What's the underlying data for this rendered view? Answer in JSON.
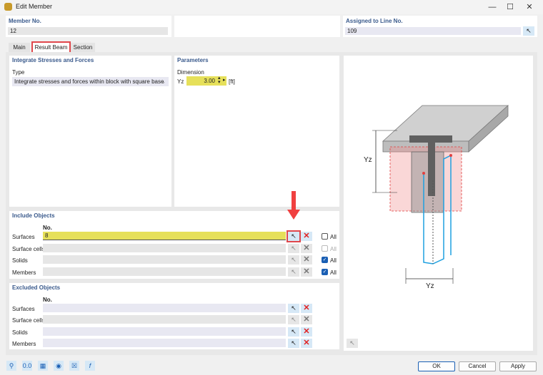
{
  "window": {
    "title": "Edit Member"
  },
  "member_no": {
    "label": "Member No.",
    "value": "12"
  },
  "assigned_line": {
    "label": "Assigned to Line No.",
    "value": "109"
  },
  "tabs": [
    {
      "label": "Main"
    },
    {
      "label": "Result Beam",
      "active": true
    },
    {
      "label": "Section"
    }
  ],
  "integrate": {
    "header": "Integrate Stresses and Forces",
    "type_label": "Type",
    "type_value": "Integrate stresses and forces within block with square base"
  },
  "parameters": {
    "header": "Parameters",
    "dimension_label": "Dimension",
    "symbol": "Yz",
    "value": "3.00",
    "unit": "[ft]"
  },
  "include": {
    "header": "Include Objects",
    "col": "No.",
    "rows": [
      {
        "label": "Surfaces",
        "value": "8",
        "all_label": "All",
        "all_checked": false,
        "enabled": true
      },
      {
        "label": "Surface cells",
        "value": "",
        "all_label": "All",
        "all_checked": false,
        "enabled": false
      },
      {
        "label": "Solids",
        "value": "",
        "all_label": "All",
        "all_checked": true,
        "enabled": false
      },
      {
        "label": "Members",
        "value": "",
        "all_label": "All",
        "all_checked": true,
        "enabled": false
      }
    ]
  },
  "excluded": {
    "header": "Excluded Objects",
    "col": "No.",
    "rows": [
      {
        "label": "Surfaces",
        "enabled": true
      },
      {
        "label": "Surface cells",
        "enabled": false
      },
      {
        "label": "Solids",
        "enabled": true
      },
      {
        "label": "Members",
        "enabled": true
      }
    ]
  },
  "diagram": {
    "label_vertical": "Yz",
    "label_horizontal": "Yz"
  },
  "footer": {
    "ok": "OK",
    "cancel": "Cancel",
    "apply": "Apply"
  },
  "colors": {
    "accent_red": "#e0474c",
    "highlight_yellow": "#e6e05a",
    "beam_blue": "#1ea0e0"
  }
}
